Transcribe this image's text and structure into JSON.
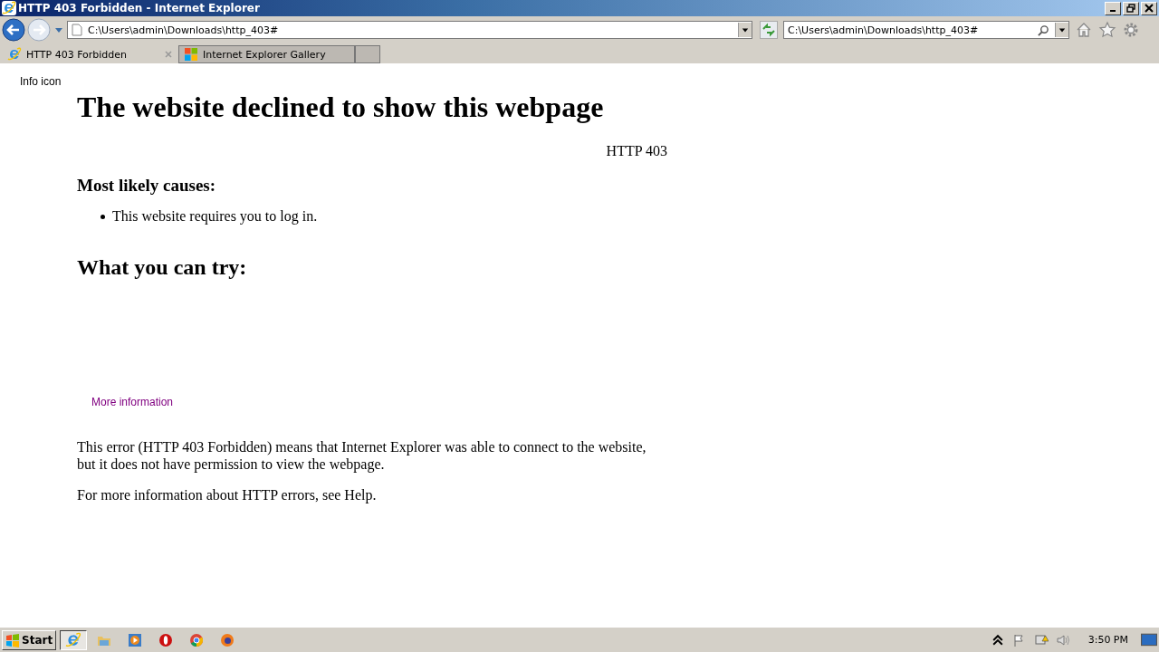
{
  "window": {
    "title": "HTTP 403 Forbidden - Internet Explorer"
  },
  "address_bar": {
    "value": "C:\\Users\\admin\\Downloads\\http_403#"
  },
  "search_bar": {
    "value": "C:\\Users\\admin\\Downloads\\http_403#"
  },
  "tabs": [
    {
      "label": "HTTP 403 Forbidden",
      "selected": true,
      "kind": "ie"
    },
    {
      "label": "Internet Explorer Gallery",
      "selected": false,
      "kind": "gallery"
    }
  ],
  "page": {
    "info_icon_alt": "Info icon",
    "heading": "The website declined to show this webpage",
    "status": "HTTP 403",
    "causes_heading": "Most likely causes:",
    "causes": [
      "This website requires you to log in."
    ],
    "try_heading": "What you can try:",
    "more_info": "More information",
    "paragraphs": [
      "This error (HTTP 403 Forbidden) means that Internet Explorer was able to connect to the website, but it does not have permission to view the webpage.",
      "For more information about HTTP errors, see Help."
    ]
  },
  "taskbar": {
    "start": "Start",
    "apps": [
      {
        "kind": "ie",
        "selected": true
      },
      {
        "kind": "folder",
        "selected": false
      },
      {
        "kind": "media",
        "selected": false
      },
      {
        "kind": "opera",
        "selected": false
      },
      {
        "kind": "chrome",
        "selected": false
      },
      {
        "kind": "firefox",
        "selected": false
      }
    ],
    "clock": "3:50 PM"
  }
}
